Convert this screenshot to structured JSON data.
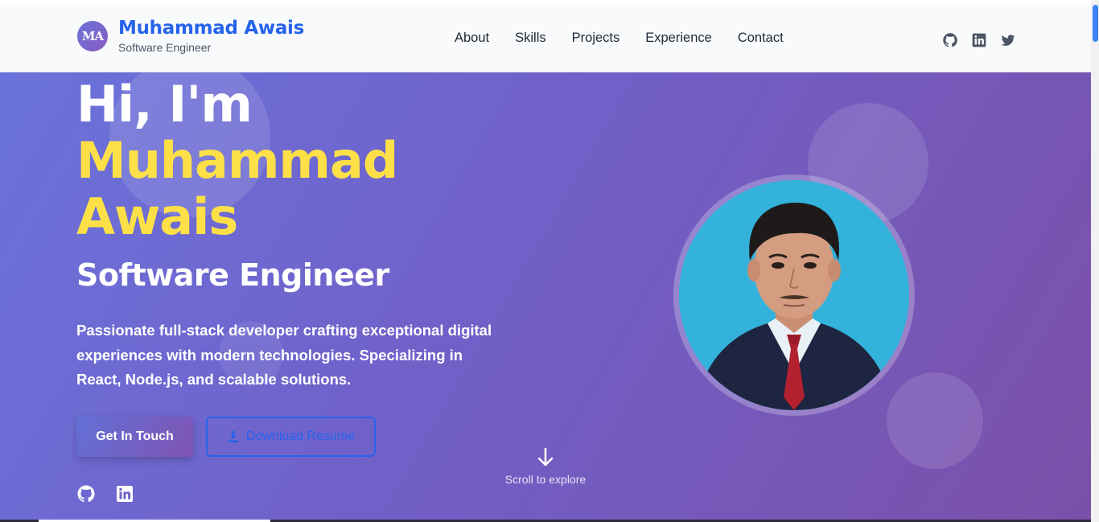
{
  "header": {
    "logo_text": "MA",
    "brand_name": "Muhammad Awais",
    "brand_subtitle": "Software Engineer",
    "nav": [
      "About",
      "Skills",
      "Projects",
      "Experience",
      "Contact"
    ],
    "social_icons": [
      "github-icon",
      "linkedin-icon",
      "twitter-icon"
    ]
  },
  "hero": {
    "greeting": "Hi, I'm",
    "first_name": "Muhammad",
    "last_name": "Awais",
    "role": "Software Engineer",
    "description": "Passionate full-stack developer crafting exceptional digital experiences with modern technologies. Specializing in React, Node.js, and scalable solutions.",
    "primary_button": "Get In Touch",
    "secondary_button": "Download Resume",
    "social_icons": [
      "github-icon",
      "linkedin-icon"
    ],
    "scroll_hint": "Scroll to explore"
  },
  "colors": {
    "brand": "#2563eb",
    "highlight": "#fde047",
    "hero_gradient_start": "#6a73db",
    "hero_gradient_end": "#7b50a9"
  }
}
